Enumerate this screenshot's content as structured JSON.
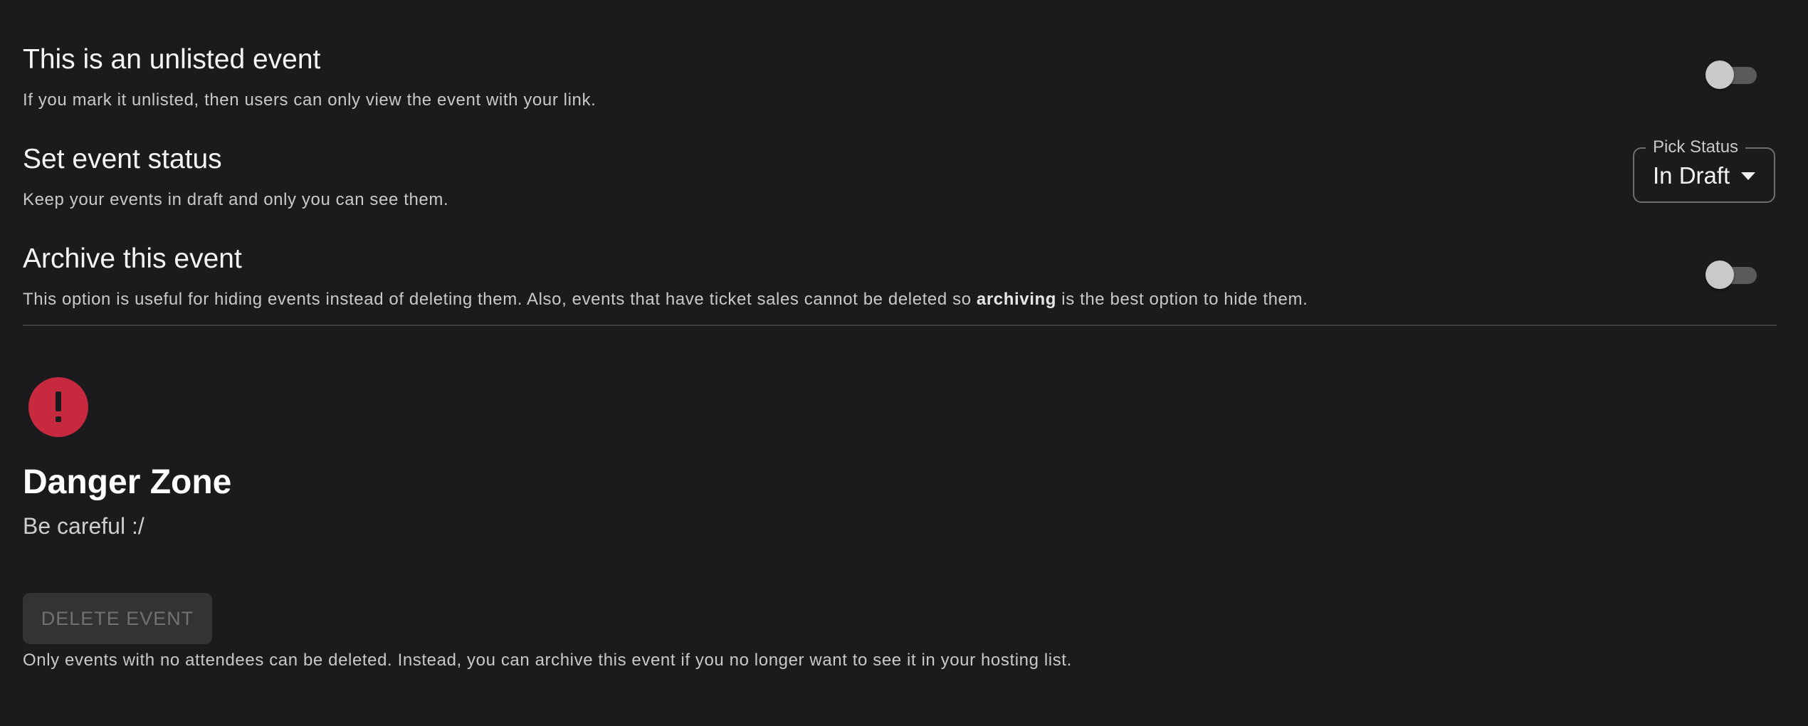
{
  "settings": {
    "unlisted": {
      "title": "This is an unlisted event",
      "description": "If you mark it unlisted, then users can only view the event with your link.",
      "toggle_on": false
    },
    "status": {
      "title": "Set event status",
      "description": "Keep your events in draft and only you can see them.",
      "select_label": "Pick Status",
      "select_value": "In Draft"
    },
    "archive": {
      "title": "Archive this event",
      "description_before": "This option is useful for hiding events instead of deleting them. Also, events that have ticket sales cannot be deleted so ",
      "description_bold": "archiving",
      "description_after": " is the best option to hide them.",
      "toggle_on": false
    }
  },
  "danger": {
    "icon": "exclamation-icon",
    "icon_color": "#c72a3f",
    "title": "Danger Zone",
    "subtitle": "Be careful :/",
    "delete_label": "DELETE EVENT",
    "delete_disabled": true,
    "note": "Only events with no attendees can be deleted. Instead, you can archive this event if you no longer want to see it in your hosting list."
  },
  "colors": {
    "background": "#1b1b1d",
    "danger": "#c72a3f"
  }
}
